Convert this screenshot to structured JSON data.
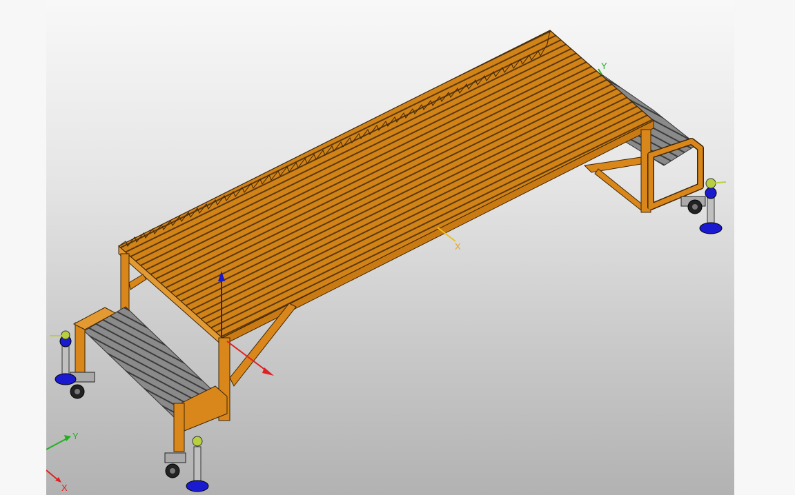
{
  "viewport": {
    "model_triad": {
      "x_label": "X",
      "y_label": "Y"
    },
    "view_triad": {
      "x_label": "X",
      "y_label": "Y"
    },
    "colors": {
      "frame": "#d9861a",
      "frame_edge": "#4a2e08",
      "grating_steel": "#7b7b7b",
      "leveling_pad": "#1a1ad0",
      "x_axis": "#e02020",
      "y_axis": "#20b020",
      "z_axis": "#1a1acc",
      "sketch_axis": "#e8c020"
    }
  }
}
